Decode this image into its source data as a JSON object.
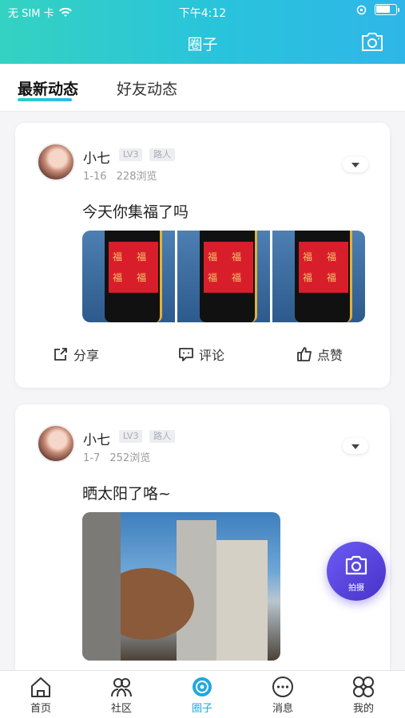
{
  "status_bar": {
    "carrier": "无 SIM 卡",
    "time": "下午4:12",
    "battery_level": 0.75
  },
  "header": {
    "title": "圈子",
    "camera_icon": "camera-icon"
  },
  "tabs": [
    {
      "label": "最新动态",
      "active": true
    },
    {
      "label": "好友动态",
      "active": false
    }
  ],
  "posts": [
    {
      "user": "小七",
      "level": "LV3",
      "role": "路人",
      "date": "1-16",
      "views": "228浏览",
      "text": "今天你集福了吗",
      "fu_chars": [
        "福",
        "福",
        "福",
        "福"
      ]
    },
    {
      "user": "小七",
      "level": "LV3",
      "role": "路人",
      "date": "1-7",
      "views": "252浏览",
      "text": "晒太阳了咯~"
    }
  ],
  "actions": {
    "share": "分享",
    "comment": "评论",
    "like": "点赞"
  },
  "fab": {
    "label": "拍摄"
  },
  "bottom_nav": [
    {
      "label": "首页",
      "icon": "home-icon"
    },
    {
      "label": "社区",
      "icon": "community-icon"
    },
    {
      "label": "圈子",
      "icon": "circle-icon",
      "active": true
    },
    {
      "label": "消息",
      "icon": "message-icon"
    },
    {
      "label": "我的",
      "icon": "mine-icon"
    }
  ],
  "colors": {
    "accent": "#21a8e0",
    "header_start": "#34d2c2",
    "fab": "#5a47e0"
  }
}
